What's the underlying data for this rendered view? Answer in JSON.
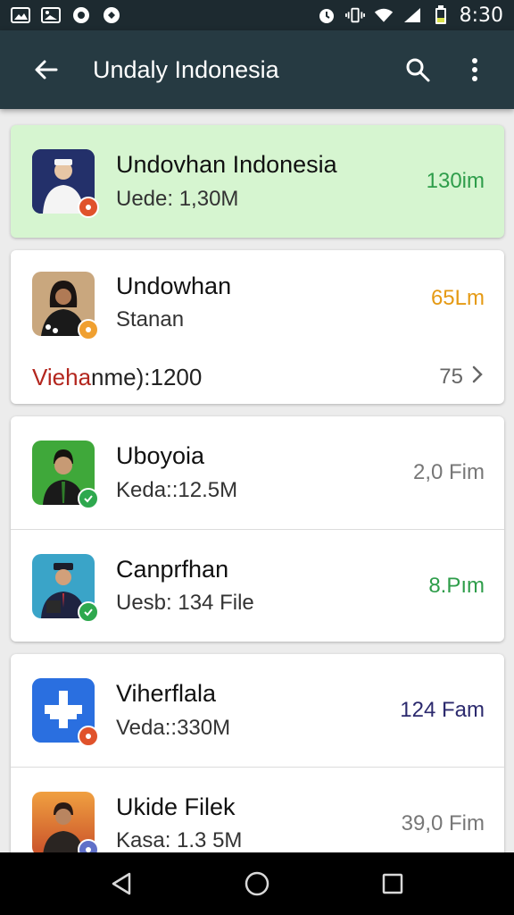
{
  "status_bar": {
    "time": "8:30",
    "left_icons": [
      "gallery-icon",
      "image-icon",
      "chat-icon",
      "sync-icon"
    ],
    "right_icons": [
      "alarm-icon",
      "vibrate-icon",
      "wifi-icon",
      "signal-icon",
      "battery-icon"
    ]
  },
  "app_bar": {
    "title": "Undaly Indonesia",
    "icons": [
      "back-arrow-icon",
      "search-icon",
      "more-vertical-icon"
    ]
  },
  "cards": [
    {
      "highlight": true,
      "rows": [
        {
          "name": "Undovhan Indonesia",
          "sub": "Uede: 1,30M",
          "meta": "130im",
          "meta_color": "#2e9d4a",
          "badge_color": "#e0522b"
        }
      ]
    },
    {
      "rows": [
        {
          "name": "Undowhan",
          "sub": "Stanan",
          "meta": "65Lm",
          "meta_color": "#e59a14",
          "badge_color": "#f0a030"
        }
      ],
      "footer": {
        "accent": "Vieha",
        "rest": "nme):1200",
        "count": "75"
      }
    },
    {
      "rows": [
        {
          "name": "Uboyoia",
          "sub": "Keda::12.5M",
          "meta": "2,0 Fim",
          "meta_color": "#777777",
          "badge_color": "#2ea84e"
        },
        {
          "name": "Canprfhan",
          "sub": "Uesb: 134 File",
          "meta": "8.Pım",
          "meta_color": "#2e9d4a",
          "badge_color": "#2ea84e"
        }
      ]
    },
    {
      "rows": [
        {
          "name": "Viherflala",
          "sub": "Veda::330M",
          "meta": "124 Fam",
          "meta_color": "#2c2a6e",
          "badge_color": "#e0522b"
        },
        {
          "name": "Ukide Filek",
          "sub": "Kasa: 1.3 5M",
          "meta": "39,0 Fim",
          "meta_color": "#777777",
          "badge_color": "#6070c8"
        }
      ]
    }
  ],
  "nav_bar": {
    "icons": [
      "back-triangle-icon",
      "home-circle-icon",
      "recents-square-icon"
    ]
  }
}
